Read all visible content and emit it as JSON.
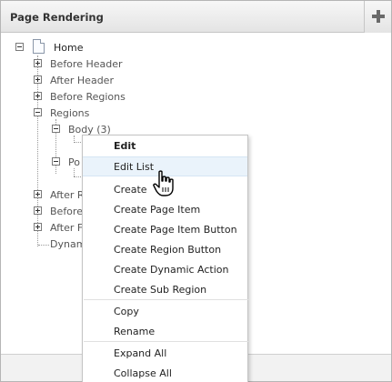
{
  "panel": {
    "title": "Page Rendering"
  },
  "tree": {
    "root": "Home",
    "nodes": [
      {
        "key": "before_header",
        "label": "Before Header"
      },
      {
        "key": "after_header",
        "label": "After Header"
      },
      {
        "key": "before_regions",
        "label": "Before Regions"
      },
      {
        "key": "regions",
        "label": "Regions"
      },
      {
        "key": "body",
        "label": "Body (3)"
      },
      {
        "key": "po",
        "label": "Po"
      },
      {
        "key": "after_r",
        "label": "After R"
      },
      {
        "key": "before",
        "label": "Before"
      },
      {
        "key": "after_fo",
        "label": "After Fo"
      },
      {
        "key": "dynam",
        "label": "Dynam"
      }
    ]
  },
  "context_menu": {
    "items": [
      {
        "label": "Edit",
        "bold": true
      },
      {
        "label": "Edit List",
        "highlight": true
      },
      {
        "label": "Create"
      },
      {
        "label": "Create Page Item"
      },
      {
        "label": "Create Page Item Button"
      },
      {
        "label": "Create Region Button"
      },
      {
        "label": "Create Dynamic Action"
      },
      {
        "label": "Create Sub Region"
      },
      {
        "label": "Copy"
      },
      {
        "label": "Rename"
      },
      {
        "label": "Expand All"
      },
      {
        "label": "Collapse All"
      }
    ]
  },
  "icons": {
    "add": "plus-icon",
    "page": "page-icon",
    "cursor": "hand-pointer-icon"
  }
}
